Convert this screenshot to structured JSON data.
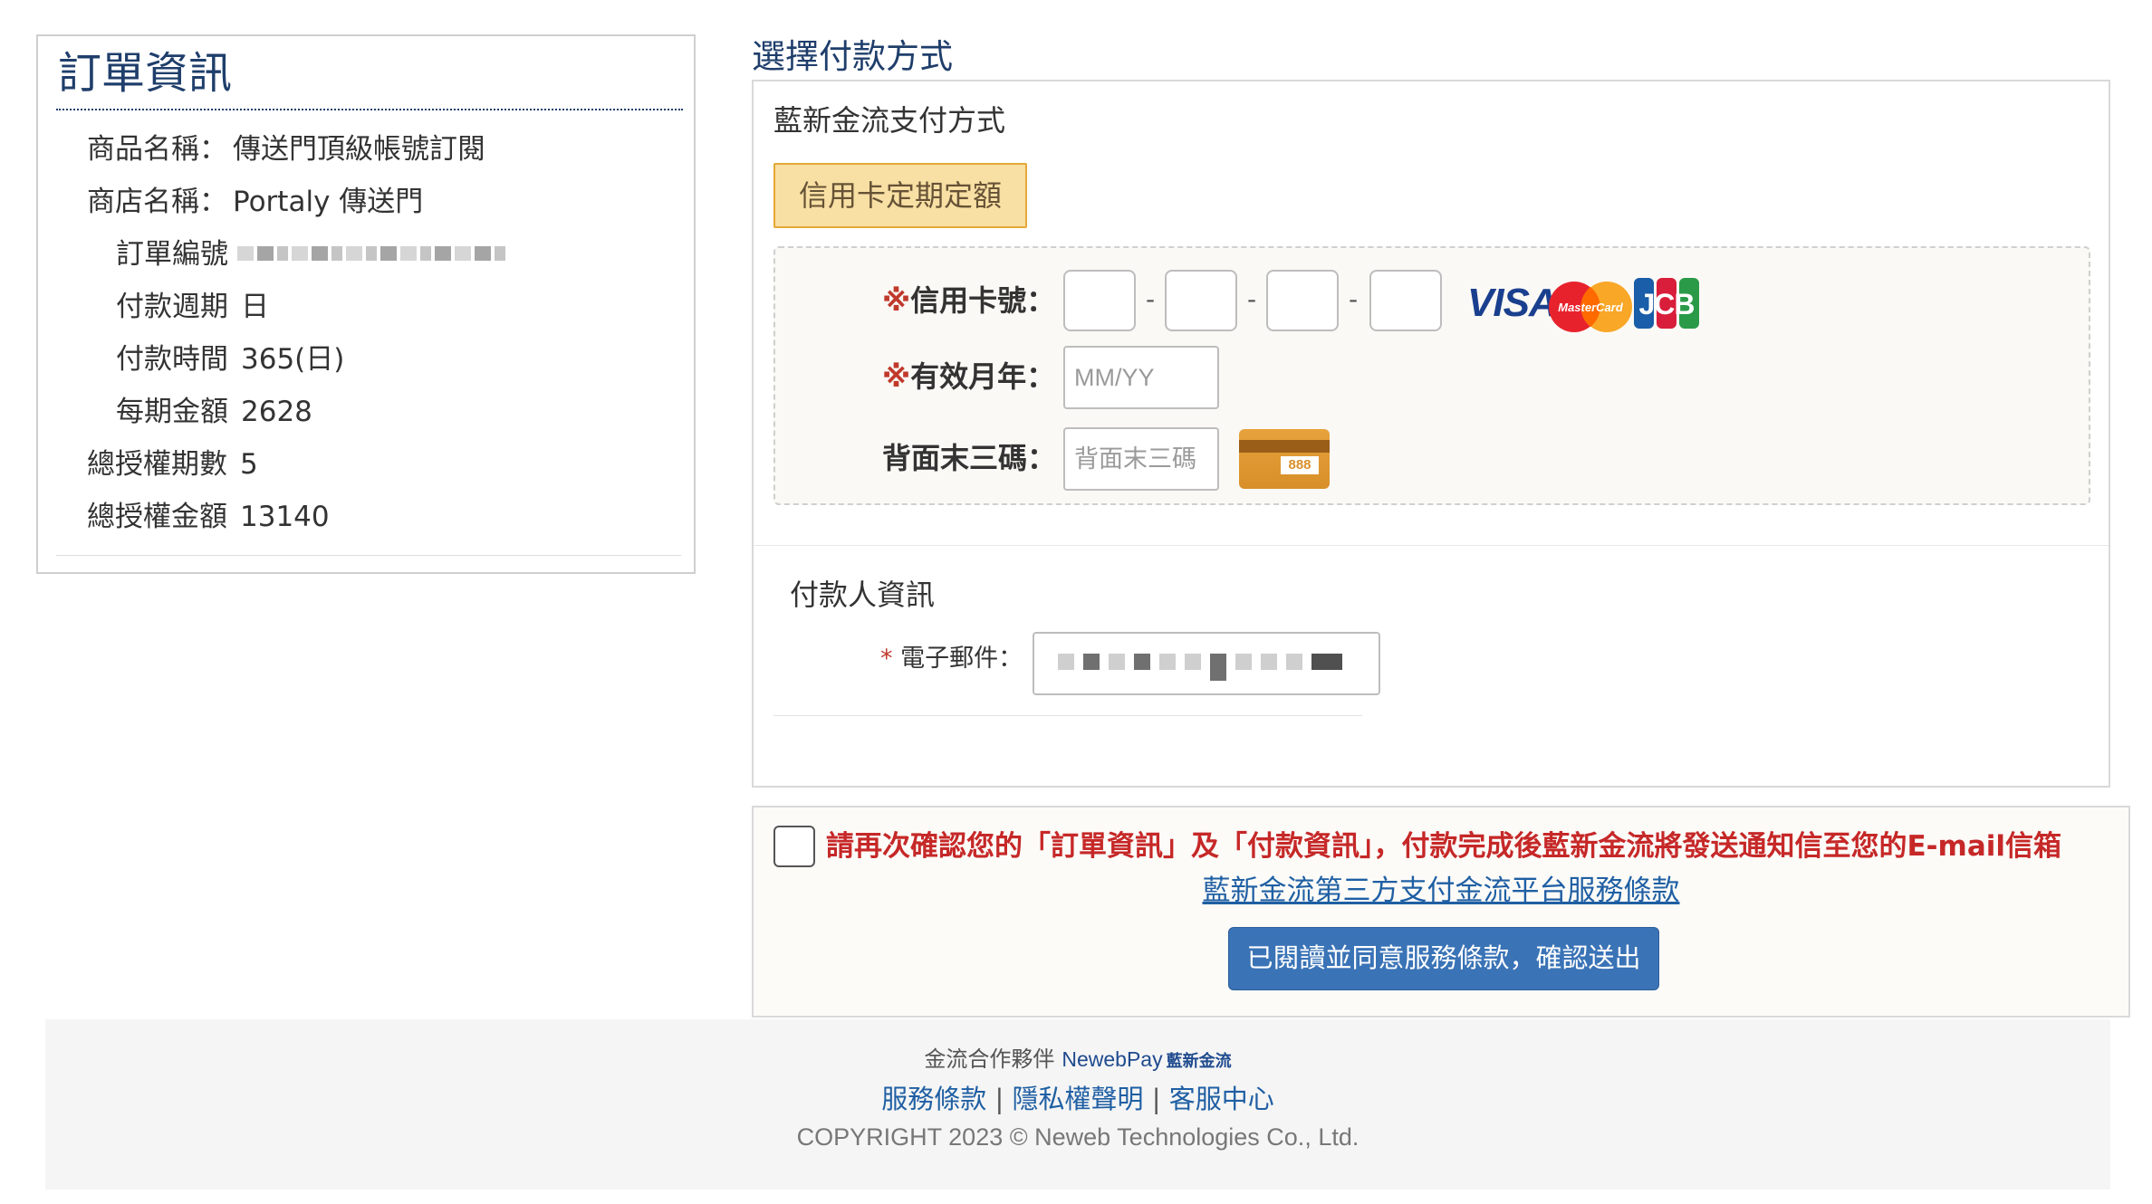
{
  "order": {
    "title": "訂單資訊",
    "rows": [
      {
        "label": "商品名稱：",
        "value": "傳送門頂級帳號訂閱"
      },
      {
        "label": "商店名稱：",
        "value": "Portaly 傳送門"
      },
      {
        "label": "訂單編號",
        "value": ""
      },
      {
        "label": "付款週期",
        "value": "日"
      },
      {
        "label": "付款時間",
        "value": "365(日)"
      },
      {
        "label": "每期金額",
        "value": "2628"
      },
      {
        "label": "總授權期數",
        "value": "5"
      },
      {
        "label": "總授權金額",
        "value": "13140"
      }
    ]
  },
  "payment": {
    "heading": "選擇付款方式",
    "subheading": "藍新金流支付方式",
    "method_tab": "信用卡定期定額",
    "card_number": {
      "required_mark": "※",
      "label": "信用卡號：",
      "separator": "-"
    },
    "expiry": {
      "required_mark": "※",
      "label": "有效月年：",
      "placeholder": "MM/YY"
    },
    "cvv": {
      "label": "背面末三碼：",
      "placeholder": "背面末三碼",
      "card_icon_text": "888"
    },
    "brands": {
      "visa": "VISA",
      "mastercard": "MasterCard",
      "jcb": "JCB"
    }
  },
  "payer": {
    "title": "付款人資訊",
    "email": {
      "required_mark": "*",
      "label": "電子郵件："
    }
  },
  "confirm": {
    "text": "請再次確認您的「訂單資訊」及「付款資訊」，付款完成後藍新金流將發送通知信至您的E-mail信箱",
    "terms_link": "藍新金流第三方支付金流平台服務條款",
    "submit": "已閱讀並同意服務條款，確認送出"
  },
  "footer": {
    "partner_label": "金流合作夥伴",
    "partner_logo": "NewebPay",
    "partner_logo_cn": "藍新金流",
    "links": [
      "服務條款",
      "隱私權聲明",
      "客服中心"
    ],
    "link_separator": "|",
    "copyright": "COPYRIGHT 2023 © Neweb Technologies Co., Ltd."
  },
  "colors": {
    "heading_blue": "#1f3e6b",
    "tab_bg": "#f8dfa3",
    "tab_border": "#e5a836",
    "warning_red": "#c62828",
    "button_blue": "#3a73b6",
    "link_blue": "#1f5fa3"
  }
}
